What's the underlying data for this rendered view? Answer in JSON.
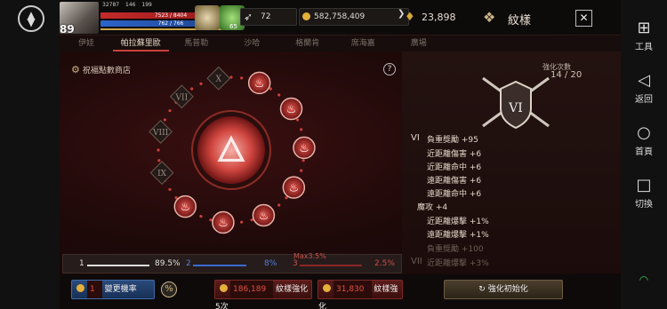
{
  "rail_right": {
    "tools_label": "工具",
    "back_label": "返回",
    "home_label": "首頁",
    "switch_label": "切換"
  },
  "player": {
    "level": "89",
    "stats": [
      "32787",
      "146",
      "199"
    ],
    "hp": "7523 / 8404",
    "mp": "762 / 766",
    "buff_count": "65"
  },
  "currency": {
    "feathers": "72",
    "gold": "582,758,409",
    "gems": "23,898"
  },
  "title": "紋樣",
  "tabs": [
    {
      "label": "伊娃",
      "active": false
    },
    {
      "label": "帕拉蘇里歐",
      "active": true
    },
    {
      "label": "馬普勒",
      "active": false
    },
    {
      "label": "沙哈",
      "active": false
    },
    {
      "label": "格蘭肯",
      "active": false
    },
    {
      "label": "席海嘉",
      "active": false
    },
    {
      "label": "廣場",
      "active": false
    }
  ],
  "shop_link": "祝福點數商店",
  "wheel": {
    "roman_slots": [
      "X",
      "IX",
      "VIII",
      "VII"
    ],
    "flame_slots": 7,
    "accent": "#c9403a"
  },
  "rates": {
    "r1_label": "1",
    "r1_value": "89.5%",
    "r2_label": "2",
    "r2_value": "8%",
    "r3_label": "3",
    "r3_value": "2.5%",
    "max_note": "Max3.5%"
  },
  "enhance": {
    "label": "強化次數",
    "count": "14 / 20",
    "crest": "VI"
  },
  "stat_block": {
    "roman": "VI",
    "lines": [
      "負重獎勵 +95",
      "近距離傷害 +6",
      "近距離命中 +6",
      "遠距離傷害 +6",
      "遠距離命中 +6",
      "魔攻 +4",
      "近距離爆擊 +1%",
      "遠距離爆擊 +1%"
    ],
    "next_roman": "VII",
    "next_lines": [
      "負重獎勵 +100",
      "近距離爆擊 +3%"
    ]
  },
  "buttons": {
    "prob_cost": "1",
    "prob_label": "變更機率",
    "discount_symbol": "%",
    "enh5_cost": "186,189",
    "enh5_label": "紋樣強化5次",
    "enh_cost": "31,830",
    "enh_label": "紋樣強化",
    "reset_label": "強化初始化"
  }
}
